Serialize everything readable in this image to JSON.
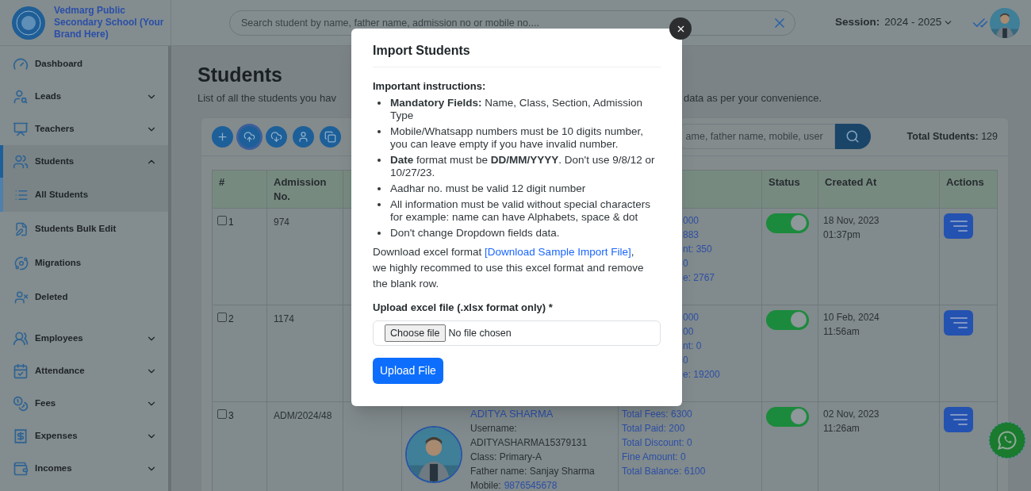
{
  "brand": {
    "name": "Vedmarg Public Secondary School (Your Brand Here)"
  },
  "header": {
    "search": {
      "placeholder": "Search student by name, father name, admission no or mobile no...."
    },
    "session_label": "Session:",
    "session_value": "2024 - 2025"
  },
  "sidebar": {
    "items": [
      {
        "label": "Dashboard",
        "kind": "link",
        "selected": false
      },
      {
        "label": "Leads",
        "kind": "group",
        "expanded": false,
        "selected": false
      },
      {
        "label": "Teachers",
        "kind": "group",
        "expanded": false,
        "selected": false
      },
      {
        "label": "Students",
        "kind": "group",
        "expanded": true,
        "selected": true,
        "children": [
          {
            "label": "All Students",
            "selected": true
          },
          {
            "label": "Students Bulk Edit",
            "selected": false
          },
          {
            "label": "Migrations",
            "selected": false
          },
          {
            "label": "Deleted",
            "selected": false
          }
        ]
      },
      {
        "label": "Employees",
        "kind": "group",
        "expanded": false,
        "selected": false
      },
      {
        "label": "Attendance",
        "kind": "group",
        "expanded": false,
        "selected": false
      },
      {
        "label": "Fees",
        "kind": "group",
        "expanded": false,
        "selected": false
      },
      {
        "label": "Expenses",
        "kind": "group",
        "expanded": false,
        "selected": false
      },
      {
        "label": "Incomes",
        "kind": "group",
        "expanded": false,
        "selected": false
      }
    ]
  },
  "page": {
    "title": "Students",
    "subtitle_start": "List of all the students you hav",
    "subtitle_end": "data as per your convenience."
  },
  "toolbar": {
    "tools": [
      {
        "selected": false
      },
      {
        "selected": true
      },
      {
        "selected": false
      },
      {
        "selected": false
      },
      {
        "selected": false
      }
    ],
    "search_placeholder": "ame, father name, mobile, user",
    "total_label": "Total Students:",
    "total_value": "129"
  },
  "table": {
    "columns": [
      "#",
      "Admission No.",
      "Status",
      "Created At",
      "Actions"
    ],
    "rows": [
      {
        "number": "1",
        "checked": false,
        "admission_no": "974",
        "fees": [
          "000",
          "883",
          "nt: 350",
          "0",
          "e: 2767"
        ],
        "status_on": true,
        "created_date": "18 Nov, 2023",
        "created_time": "01:37pm"
      },
      {
        "number": "2",
        "checked": false,
        "admission_no": "1174",
        "fees": [
          "000",
          "00",
          "nt: 0",
          "0",
          "e: 19200"
        ],
        "status_on": true,
        "created_date": "10 Feb, 2024",
        "created_time": "11:56am"
      },
      {
        "number": "3",
        "checked": false,
        "admission_no": "ADM/2024/48",
        "student": {
          "name": "ADITYA SHARMA",
          "username": "Username: ADITYASHARMA15379131",
          "class": "Class: Primary-A",
          "father": "Father name: Sanjay Sharma",
          "mobile_label": "Mobile:",
          "mobile": "9876545678"
        },
        "fees": [
          "Total Fees: 6300",
          "Total Paid: 200",
          "Total Discount: 0",
          "Fine Amount: 0",
          "Total Balance: 6100"
        ],
        "status_on": true,
        "created_date": "02 Nov, 2023",
        "created_time": "11:26am"
      }
    ]
  },
  "modal": {
    "title": "Import Students",
    "instructions_heading": "Important instructions:",
    "instructions": [
      "**Mandatory Fields:** Name, Class, Section, Admission Type",
      "Mobile/Whatsapp numbers must be 10 digits number, you can leave empty if you have invalid number.",
      "**Date** format must be **DD/MM/YYYY**. Don't use 9/8/12 or 10/27/23.",
      "Aadhar no. must be valid 12 digit number",
      "All information must be valid without special characters for example: name can have Alphabets, space & dot",
      "Don't change Dropdown fields data."
    ],
    "download_before": "Download excel format ",
    "download_link": "[Download Sample Import File]",
    "download_after": ", we highly recommed to use this excel format and remove the blank row.",
    "upload_label": "Upload excel file (.xlsx format only) *",
    "choose_button": "Choose file",
    "file_status": "No file chosen",
    "submit": "Upload File"
  }
}
